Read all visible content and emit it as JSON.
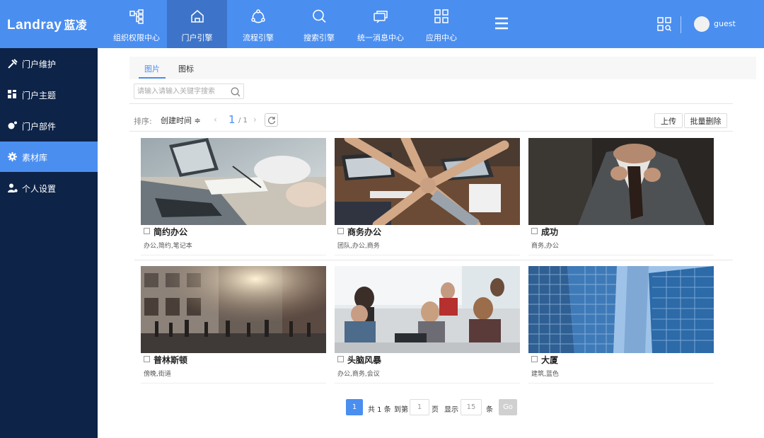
{
  "brand": {
    "logo_en": "Landray",
    "logo_cn": "蓝凌"
  },
  "topnav": [
    {
      "label": "组织权限中心",
      "icon": "org-structure-icon"
    },
    {
      "label": "门户引擎",
      "icon": "home-icon"
    },
    {
      "label": "流程引擎",
      "icon": "process-flow-icon"
    },
    {
      "label": "搜索引擎",
      "icon": "search-icon"
    },
    {
      "label": "统一消息中心",
      "icon": "message-icon"
    },
    {
      "label": "应用中心",
      "icon": "apps-grid-icon"
    }
  ],
  "active_nav": "门户引擎",
  "user": {
    "name": "guest"
  },
  "sidebar": {
    "items": [
      {
        "label": "门户维护",
        "icon": "tools-icon"
      },
      {
        "label": "门户主题",
        "icon": "theme-icon"
      },
      {
        "label": "门户部件",
        "icon": "widget-icon"
      },
      {
        "label": "素材库",
        "icon": "gear-icon"
      },
      {
        "label": "个人设置",
        "icon": "user-settings-icon"
      }
    ],
    "active": "素材库"
  },
  "tabs": [
    {
      "label": "图片"
    },
    {
      "label": "图标"
    }
  ],
  "search": {
    "placeholder": "请输入请输入关键字搜索"
  },
  "toolbar": {
    "sort_label": "排序:",
    "sort_value": "创建时间 ≑",
    "page_current": "1",
    "page_sep": "/ 1",
    "upload_label": "上传",
    "batch_delete_label": "批量删除"
  },
  "cards": [
    {
      "title": "简约办公",
      "tags": "办公,简约,笔记本"
    },
    {
      "title": "商务办公",
      "tags": "团队,办公,商务"
    },
    {
      "title": "成功",
      "tags": "商务,办公"
    },
    {
      "title": "普林斯顿",
      "tags": "傍晚,街道"
    },
    {
      "title": "头脑风暴",
      "tags": "办公,商务,会议"
    },
    {
      "title": "大厦",
      "tags": "建筑,蓝色"
    }
  ],
  "pagination": {
    "current": "1",
    "total_text": "共 1 条",
    "goto_label": "到第",
    "goto_value": "1",
    "page_unit": "页",
    "show_label": "显示",
    "page_size": "15",
    "size_unit": "条",
    "go_label": "Go"
  },
  "colors": {
    "accent": "#4a8ef0",
    "sidebar": "#0d2347",
    "nav_active": "#3d74c9"
  }
}
